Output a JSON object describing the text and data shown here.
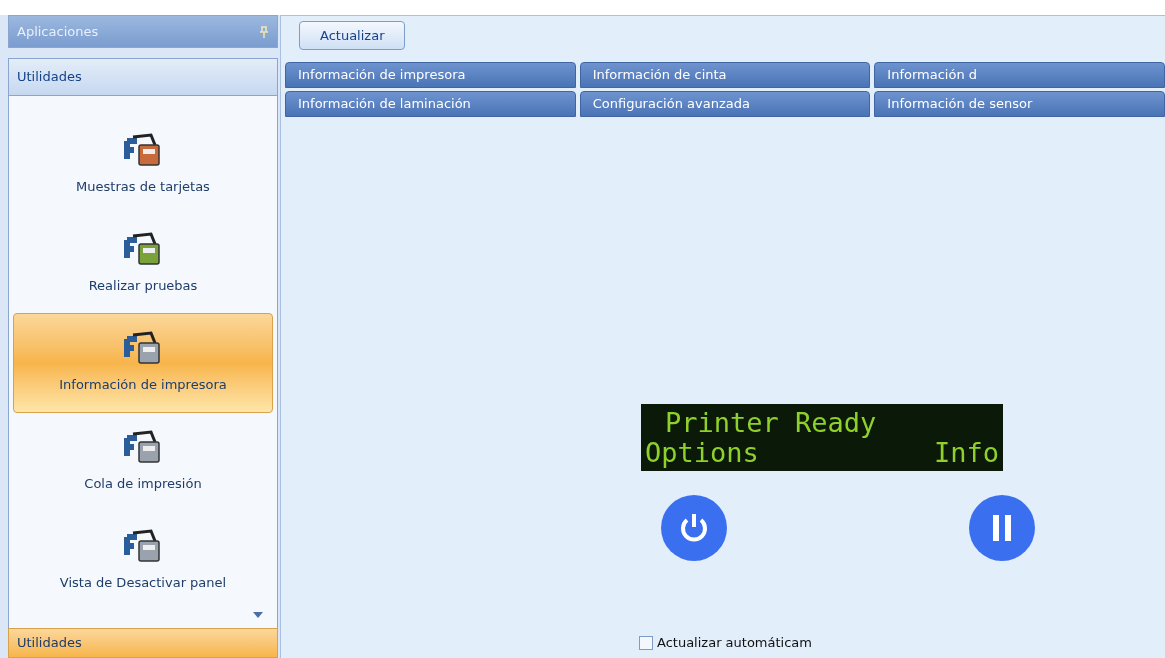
{
  "sidebar": {
    "title": "Aplicaciones",
    "group": "Utilidades",
    "items": [
      {
        "label": "Muestras de tarjetas",
        "selected": false
      },
      {
        "label": "Realizar pruebas",
        "selected": false
      },
      {
        "label": "Información de impresora",
        "selected": true
      },
      {
        "label": "Cola de impresión",
        "selected": false
      },
      {
        "label": "Vista de Desactivar panel",
        "selected": false
      }
    ],
    "footer_group": "Utilidades"
  },
  "toolbar": {
    "button": "Actualizar"
  },
  "tabs": [
    [
      {
        "label": "Información de impresora",
        "selected": false
      },
      {
        "label": "Información de cinta",
        "selected": false
      },
      {
        "label": "Información d",
        "selected": false
      }
    ],
    [
      {
        "label": "Información de laminación",
        "selected": false
      },
      {
        "label": "Configuración avanzada",
        "selected": false
      },
      {
        "label": "Información de sensor",
        "selected": false
      }
    ]
  ],
  "display": {
    "line_1": "Printer Ready",
    "line_2_left": "Options",
    "line_2_right": "Info"
  },
  "auto_refresh": {
    "label": "Actualizar automáticam",
    "checked": false
  }
}
